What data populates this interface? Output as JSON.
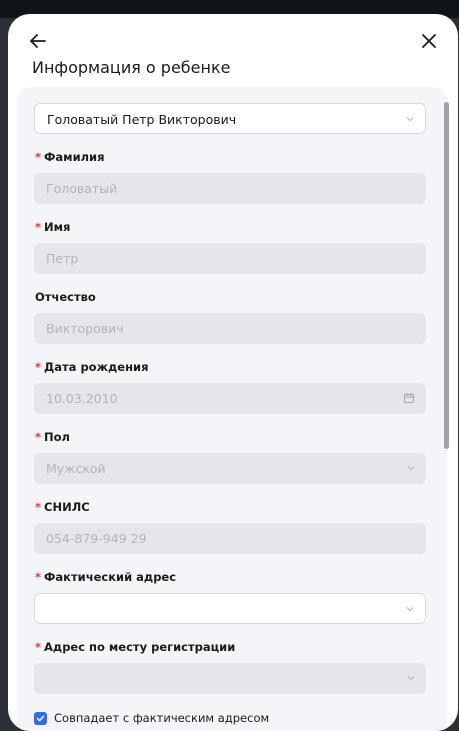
{
  "header": {
    "title": "Информация о ребенке"
  },
  "child_select": {
    "value": "Головатый Петр Викторович"
  },
  "fields": {
    "surname": {
      "label": "Фамилия",
      "value": "Головатый"
    },
    "name": {
      "label": "Имя",
      "value": "Петр"
    },
    "patronymic": {
      "label": "Отчество",
      "value": "Викторович"
    },
    "birthdate": {
      "label": "Дата рождения",
      "value": "10.03.2010"
    },
    "gender": {
      "label": "Пол",
      "value": "Мужской"
    },
    "snils": {
      "label": "СНИЛС",
      "value": "054-879-949 29"
    },
    "actual_address": {
      "label": "Фактический адрес",
      "value": ""
    },
    "registration_address": {
      "label": "Адрес по месту регистрации",
      "value": ""
    }
  },
  "checkbox": {
    "label": "Совпадает с фактическим адресом",
    "checked": true
  },
  "colors": {
    "accent": "#2f6fed",
    "required": "#e5383b",
    "disabled_bg": "#e5e6ec",
    "panel_bg": "#f4f5f8"
  }
}
